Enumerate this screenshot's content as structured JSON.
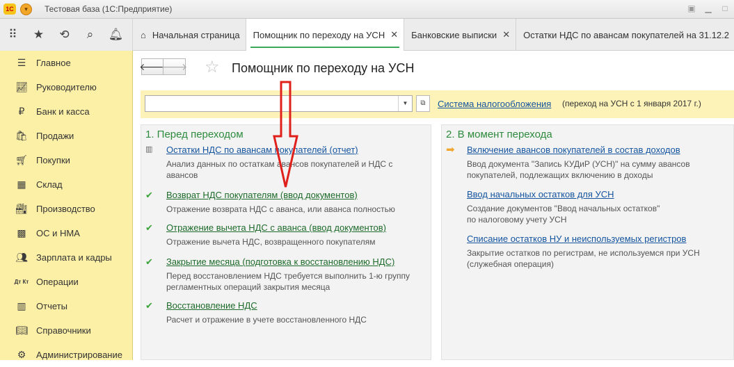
{
  "window": {
    "logo_text": "1С",
    "title": "Тестовая база  (1С:Предприятие)"
  },
  "tabs": [
    {
      "label": "Начальная страница",
      "icon": "home-icon",
      "active": false,
      "closable": false
    },
    {
      "label": "Помощник по переходу на УСН",
      "active": true,
      "closable": true
    },
    {
      "label": "Банковские выписки",
      "active": false,
      "closable": true
    },
    {
      "label": "Остатки НДС по авансам покупателей на 31.12.2",
      "active": false,
      "closable": false
    }
  ],
  "sidebar": {
    "items": [
      {
        "label": "Главное",
        "icon": "menu-lines-icon"
      },
      {
        "label": "Руководителю",
        "icon": "trend-chart-icon"
      },
      {
        "label": "Банк и касса",
        "icon": "ruble-coin-icon"
      },
      {
        "label": "Продажи",
        "icon": "shopping-bag-icon"
      },
      {
        "label": "Покупки",
        "icon": "shopping-cart-icon"
      },
      {
        "label": "Склад",
        "icon": "warehouse-grid-icon"
      },
      {
        "label": "Производство",
        "icon": "factory-icon"
      },
      {
        "label": "ОС и НМА",
        "icon": "asset-box-icon"
      },
      {
        "label": "Зарплата и кадры",
        "icon": "people-icon"
      },
      {
        "label": "Операции",
        "icon": "debit-credit-icon",
        "icon_text": "Дт Кт"
      },
      {
        "label": "Отчеты",
        "icon": "bar-chart-icon"
      },
      {
        "label": "Справочники",
        "icon": "book-icon"
      },
      {
        "label": "Администрирование",
        "icon": "gear-icon"
      }
    ]
  },
  "page": {
    "title": "Помощник по переходу на УСН",
    "taxation_link": "Система налогообложения",
    "taxation_note": "(переход на УСН с 1 января 2017 г.)",
    "combo_value": ""
  },
  "left_panel": {
    "title": "1. Перед переходом",
    "items": [
      {
        "icon": "report-icon",
        "link": "Остатки НДС по авансам покупателей (отчет)",
        "desc": [
          "Анализ данных по остаткам авансов покупателей и НДС с",
          "авансов"
        ]
      },
      {
        "icon": "check-icon",
        "link": "Возврат НДС покупателям (ввод документов)",
        "desc": [
          "Отражение возврата НДС с аванса, или аванса полностью"
        ]
      },
      {
        "icon": "check-icon",
        "link": "Отражение вычета НДС с аванса (ввод документов)",
        "desc": [
          "Отражение вычета НДС, возвращенного покупателям"
        ]
      },
      {
        "icon": "check-icon",
        "link": "Закрытие месяца (подготовка к восстановлению НДС)",
        "desc": [
          "Перед восстановлением НДС требуется выполнить 1-ю группу",
          "регламентных операций закрытия месяца"
        ]
      },
      {
        "icon": "check-icon",
        "link": "Восстановление НДС",
        "desc": [
          "Расчет и отражение в учете восстановленного НДС"
        ]
      }
    ]
  },
  "right_panel": {
    "title": "2. В момент перехода",
    "items": [
      {
        "icon": "current-step-arrow-icon",
        "link": "Включение авансов покупателей в состав доходов",
        "desc": [
          "Ввод документа \"Запись КУДиР (УСН)\" на сумму авансов",
          "покупателей, подлежащих включению в доходы"
        ]
      },
      {
        "icon": "",
        "link": "Ввод начальных остатков для УСН",
        "desc": [
          "Создание документов \"Ввод начальных остатков\"",
          "по налоговому учету УСН"
        ]
      },
      {
        "icon": "",
        "link": "Списание остатков НУ и неиспользуемых регистров",
        "desc": [
          "Закрытие остатков по  регистрам, не используемся при УСН",
          "(служебная операция)"
        ]
      }
    ]
  },
  "colors": {
    "sidebar_bg": "#fcf0a7",
    "link_blue": "#14549f",
    "section_green": "#2e8b3e",
    "annotation_red": "#e0201a"
  }
}
